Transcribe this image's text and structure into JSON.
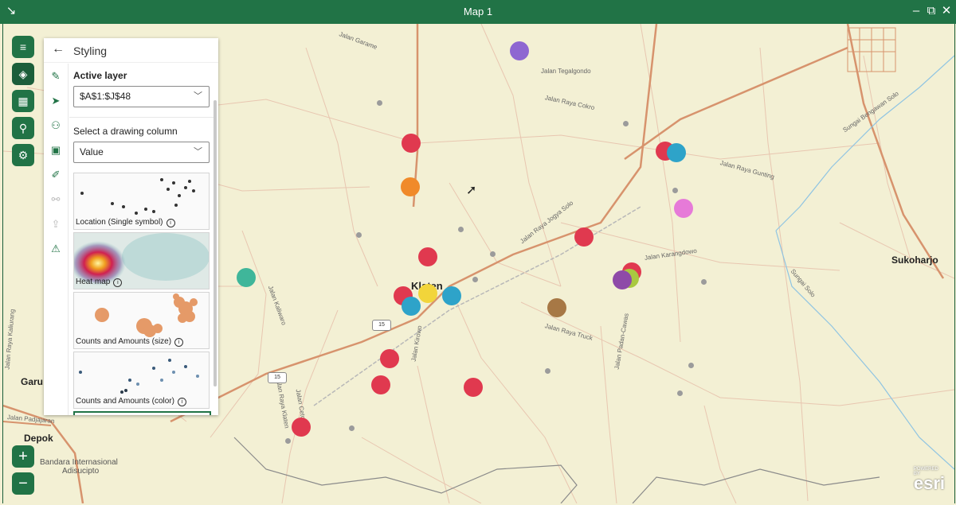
{
  "window": {
    "title": "Map 1",
    "restore_label": "↘",
    "minimize_label": "–",
    "maximize_label": "⧉",
    "close_label": "✕"
  },
  "panel": {
    "title": "Styling",
    "active_layer_label": "Active layer",
    "active_layer_value": "$A$1:$J$48",
    "drawing_column_label": "Select a drawing column",
    "drawing_column_value": "Value",
    "styles": [
      {
        "label": "Location (Single symbol)"
      },
      {
        "label": "Heat map"
      },
      {
        "label": "Counts and Amounts (size)"
      },
      {
        "label": "Counts and Amounts (color)"
      }
    ]
  },
  "map": {
    "places": {
      "klaten": "Klaten",
      "sukoharjo": "Sukoharjo",
      "depok": "Depok",
      "garu": "Garu",
      "bandara": "Bandara Internasional",
      "adisucipto": "Adisucipto"
    },
    "roads": {
      "tegalgondo": "Jalan Tegalgondo",
      "cokro": "Jalan Raya Cokro",
      "jogja_solo": "Jalan Raya Jogya Solo",
      "gunting": "Jalan Raya Gunting",
      "karangdowo": "Jalan Karangdowo",
      "truck": "Jalan Raya Truck",
      "bengawan": "Sungai Bengawan Solo",
      "sungai_solo": "Sungai Solo",
      "kaliwaro": "Jalan Kaliwaro",
      "padan": "Jalan Padan-Cawas",
      "raya_klaten": "Jalan Raya Klaten",
      "cetok": "Jalan Cetok",
      "kalurang": "Jalan Raya Kaliurang",
      "padjajaran": "Jalan Padjajaran",
      "kirowo": "Jalan Kirowo",
      "garame": "Jalan Garame"
    },
    "highways": [
      "15",
      "15"
    ],
    "attribution": "esri",
    "powered_by": "POWERED BY"
  },
  "colors": {
    "accent": "#217346",
    "red": "#e0394f",
    "orange": "#f08a2a",
    "purple": "#7b4fd0",
    "teal": "#3fb69a",
    "cyan": "#2ea3c9",
    "pink": "#e67ad8",
    "yellow": "#f2d53a",
    "brown": "#a77845",
    "violet": "#8e4aa8",
    "lime": "#a9c940"
  },
  "icons": {
    "menu": "hamburger-icon",
    "layers": "layers-icon",
    "grid": "table-icon",
    "search": "search-icon",
    "settings": "user-settings-icon",
    "zoom_in": "plus-icon",
    "zoom_out": "minus-icon"
  },
  "zoom": {
    "in_label": "+",
    "out_label": "−"
  }
}
